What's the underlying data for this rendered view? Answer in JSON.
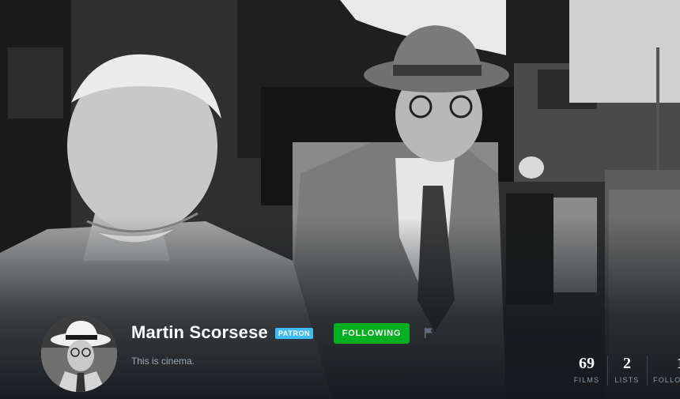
{
  "profile": {
    "name": "Martin Scorsese",
    "badge": "PATRON",
    "follow_label": "FOLLOWING",
    "bio": "This is cinema."
  },
  "stats": [
    {
      "value": "69",
      "label": "FILMS"
    },
    {
      "value": "2",
      "label": "LISTS"
    },
    {
      "value": "1",
      "label": "FOLLO"
    }
  ],
  "colors": {
    "background": "#14181c",
    "follow_button": "#00b020",
    "badge": "#40bcf4"
  },
  "icons": {
    "flag": "flag-icon"
  }
}
